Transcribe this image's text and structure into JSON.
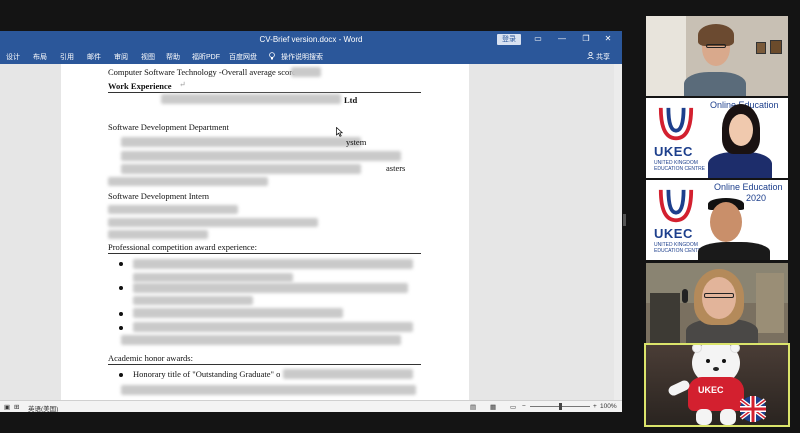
{
  "word": {
    "title": "CV-Brief version.docx  -  Word",
    "login_label": "登录",
    "window_controls": {
      "ribbon_display": "▭",
      "minimize": "—",
      "restore": "❐",
      "close": "✕"
    },
    "ribbon_tabs": [
      "设计",
      "布局",
      "引用",
      "邮件",
      "审阅",
      "视图",
      "帮助",
      "福昕PDF",
      "百度网盘",
      "操作说明搜索"
    ],
    "share_label": "共享",
    "document": {
      "line_course": "Computer Software Technology -Overall average score",
      "heading_work": "Work Experience",
      "dept_1": "Software Development Department",
      "dept_2": "Software Development Intern",
      "heading_awards": "Professional competition award experience:",
      "heading_honors": "Academic honor awards:",
      "honor_1": "Honorary title of \"Outstanding Graduate\" o",
      "partial_company": "Ltd",
      "partial_system": "ystem",
      "partial_masters": "asters"
    },
    "status": {
      "language": "英语(美国)",
      "zoom": "100%"
    }
  },
  "participants": [
    {
      "label": ""
    },
    {
      "logo_text": "UKEC",
      "logo_sub": "UNITED KINGDOM EDUCATION CENTRE",
      "banner": "Online Education"
    },
    {
      "logo_text": "UKEC",
      "logo_sub": "UNITED KINGDOM EDUCATION CENTRE",
      "banner": "Online Education",
      "year": "2020"
    },
    {
      "label": ""
    },
    {
      "mascot_shirt": "UKEC"
    }
  ],
  "colors": {
    "word_blue": "#2b579a",
    "ukec_blue": "#1d3f8c",
    "ukec_red": "#d3202f",
    "active_border": "#dbe46b"
  }
}
